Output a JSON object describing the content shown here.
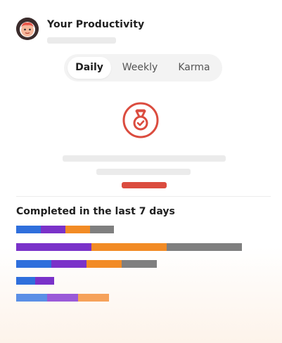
{
  "header": {
    "title": "Your Productivity",
    "avatar_icon": "user-avatar"
  },
  "tabs": [
    {
      "label": "Daily",
      "active": true
    },
    {
      "label": "Weekly",
      "active": false
    },
    {
      "label": "Karma",
      "active": false
    }
  ],
  "medal_icon": "medal-check-icon",
  "colors": {
    "accent_red": "#db4c3f",
    "blue": "#2f6fdc",
    "purple": "#7a32c9",
    "orange": "#f28b25",
    "gray": "#7f7f7f"
  },
  "completed": {
    "title": "Completed in the last 7 days"
  },
  "chart_data": {
    "type": "bar",
    "orientation": "horizontal",
    "stacked": true,
    "series_colors": [
      "#2f6fdc",
      "#7a32c9",
      "#f28b25",
      "#7f7f7f"
    ],
    "rows": [
      [
        35,
        35,
        35,
        34
      ],
      [
        0,
        107,
        107,
        107
      ],
      [
        50,
        50,
        50,
        50
      ],
      [
        27,
        27,
        0,
        0
      ],
      [
        44,
        44,
        44,
        0
      ]
    ],
    "units": "px-relative"
  }
}
